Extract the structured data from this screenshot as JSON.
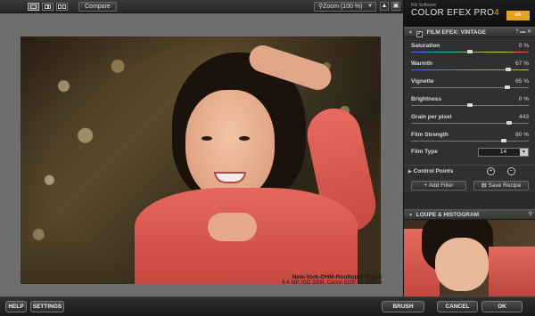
{
  "toolbar": {
    "view_modes": [
      "single-view",
      "split-view",
      "side-by-side-view"
    ],
    "compare_label": "Compare",
    "zoom_value": "Zoom (100 %)"
  },
  "image": {
    "filename": "New-York-OHM-Rooftop-175.psd",
    "meta": "6.4 MP, ISO 3200, Canon EOS 5D Mark II"
  },
  "panel": {
    "brand_maker": "Nik Software",
    "brand_product": "COLOR EFEX PRO",
    "brand_version": "4",
    "filter_title": "FILM EFEX: VINTAGE",
    "sliders": [
      {
        "label": "Saturation",
        "value": "0 %",
        "level": 0.5
      },
      {
        "label": "Warmth",
        "value": "67 %",
        "level": 0.84
      },
      {
        "label": "Vignette",
        "value": "65 %",
        "level": 0.83
      },
      {
        "label": "Brightness",
        "value": "0 %",
        "level": 0.5
      },
      {
        "label": "Grain per pixel",
        "value": "443",
        "level": 0.85
      },
      {
        "label": "Film Strength",
        "value": "80 %",
        "level": 0.8
      }
    ],
    "film_type_label": "Film Type",
    "film_type_value": "14",
    "control_points_label": "Control Points",
    "add_filter_label": "Add Filter",
    "save_recipe_label": "Save Recipe",
    "loupe_title": "LOUPE & HISTOGRAM"
  },
  "bottom": {
    "help_label": "HELP",
    "settings_label": "SETTINGS",
    "brush_label": "BRUSH",
    "cancel_label": "CANCEL",
    "ok_label": "OK"
  }
}
